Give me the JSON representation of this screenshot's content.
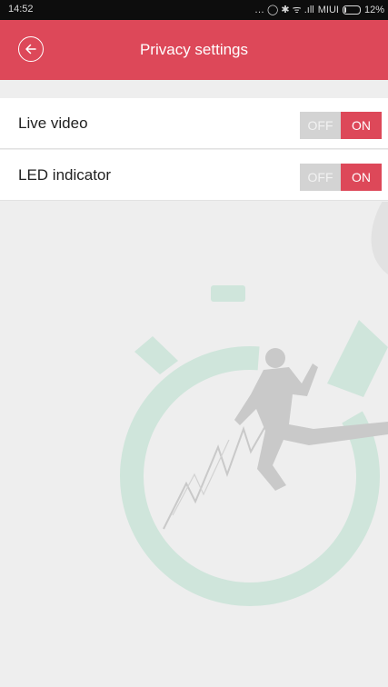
{
  "status_bar": {
    "time": "14:52",
    "indicators": "… ◯ ✱ ᯤ .ıll",
    "carrier": "MIUI",
    "battery": "12%"
  },
  "header": {
    "title": "Privacy settings",
    "back_icon": "back-arrow-circle-icon",
    "background_color": "#dd4859"
  },
  "settings": [
    {
      "label": "Live video",
      "off_label": "OFF",
      "on_label": "ON",
      "state": "ON"
    },
    {
      "label": "LED indicator",
      "off_label": "OFF",
      "on_label": "ON",
      "state": "ON"
    }
  ],
  "colors": {
    "accent": "#dd4859",
    "toggle_off": "#d3d3d3",
    "watermark_ring": "#cfe5db",
    "watermark_figure": "#c9c9c9"
  }
}
